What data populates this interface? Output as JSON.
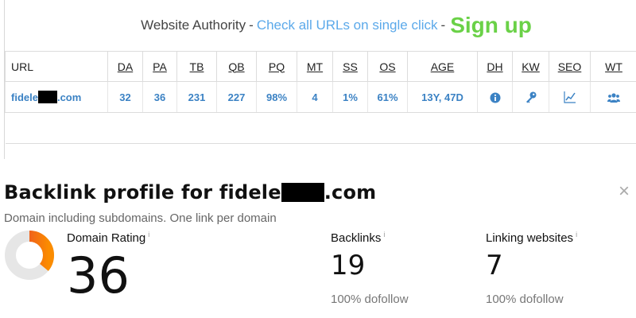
{
  "authority": {
    "title": "Website Authority",
    "dash1": "-",
    "cta_link": "Check all URLs on single click",
    "dash2": "-",
    "signup": "Sign up",
    "columns": [
      "URL",
      "DA",
      "PA",
      "TB",
      "QB",
      "PQ",
      "MT",
      "SS",
      "OS",
      "AGE",
      "DH",
      "KW",
      "SEO",
      "WT"
    ],
    "row": {
      "url_prefix": "fidele",
      "url_suffix": ".com",
      "values": [
        "32",
        "36",
        "231",
        "227",
        "98%",
        "4",
        "1%",
        "61%",
        "13Y, 47D"
      ],
      "icons": [
        "info-icon",
        "key-icon",
        "chart-icon",
        "users-icon"
      ]
    },
    "colors": {
      "link": "#5ba9ea",
      "signup": "#6ad147",
      "value": "#3b82c4"
    }
  },
  "profile": {
    "title_prefix": "Backlink profile for fidele",
    "title_suffix": ".com",
    "close": "×",
    "subtitle": "Domain including subdomains. One link per domain",
    "domain_rating": {
      "label": "Domain Rating",
      "info": "i",
      "value": "36",
      "gauge_fraction": 0.36,
      "gauge_colors": [
        "#e53935",
        "#fb8c00"
      ]
    },
    "backlinks": {
      "label": "Backlinks",
      "info": "i",
      "value": "19",
      "note": "100% dofollow"
    },
    "linking": {
      "label": "Linking websites",
      "info": "i",
      "value": "7",
      "note": "100% dofollow"
    }
  }
}
